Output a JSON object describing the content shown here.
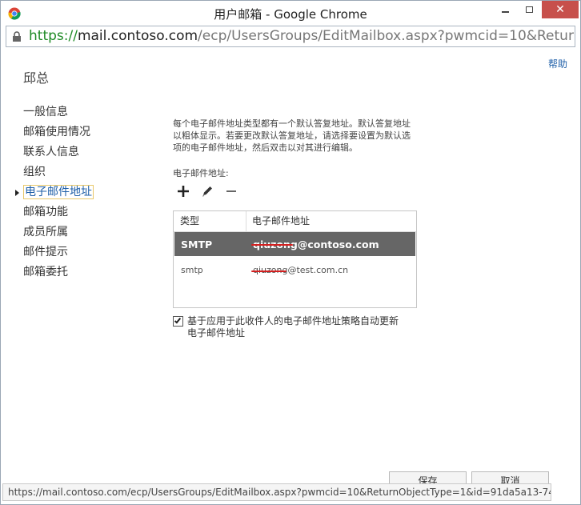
{
  "window": {
    "title": "用户邮箱 - Google Chrome",
    "close_icon": "close-icon",
    "minimize_icon": "minimize-icon",
    "maximize_icon": "maximize-icon"
  },
  "address": {
    "scheme": "https://",
    "host": "mail.contoso.com",
    "path": "/ecp/UsersGroups/EditMailbox.aspx?pwmcid=10&ReturnObjectT"
  },
  "help": "帮助",
  "page": {
    "title": "邱总"
  },
  "nav": {
    "items": [
      {
        "label": "一般信息"
      },
      {
        "label": "邮箱使用情况"
      },
      {
        "label": "联系人信息"
      },
      {
        "label": "组织"
      },
      {
        "label": "电子邮件地址",
        "active": true
      },
      {
        "label": "邮箱功能"
      },
      {
        "label": "成员所属"
      },
      {
        "label": "邮件提示"
      },
      {
        "label": "邮箱委托"
      }
    ]
  },
  "content": {
    "description": "每个电子邮件地址类型都有一个默认答复地址。默认答复地址以粗体显示。若要更改默认答复地址，请选择要设置为默认选项的电子邮件地址，然后双击以对其进行编辑。",
    "email_label": "电子邮件地址:",
    "toolbar": {
      "add_icon": "plus-icon",
      "edit_icon": "pencil-icon",
      "remove_icon": "minus-icon"
    },
    "grid": {
      "col_type": "类型",
      "col_address": "电子邮件地址",
      "rows": [
        {
          "type": "SMTP",
          "address": "qiuzong@contoso.com"
        },
        {
          "type": "smtp",
          "address": "qiuzong@test.com.cn"
        }
      ]
    },
    "auto_update_checked": true,
    "auto_update_label": "基于应用于此收件人的电子邮件地址策略自动更新电子邮件地址"
  },
  "buttons": {
    "save": "保存",
    "cancel": "取消"
  },
  "status_url": "https://mail.contoso.com/ecp/UsersGroups/EditMailbox.aspx?pwmcid=10&ReturnObjectType=1&id=91da5a13-74..."
}
